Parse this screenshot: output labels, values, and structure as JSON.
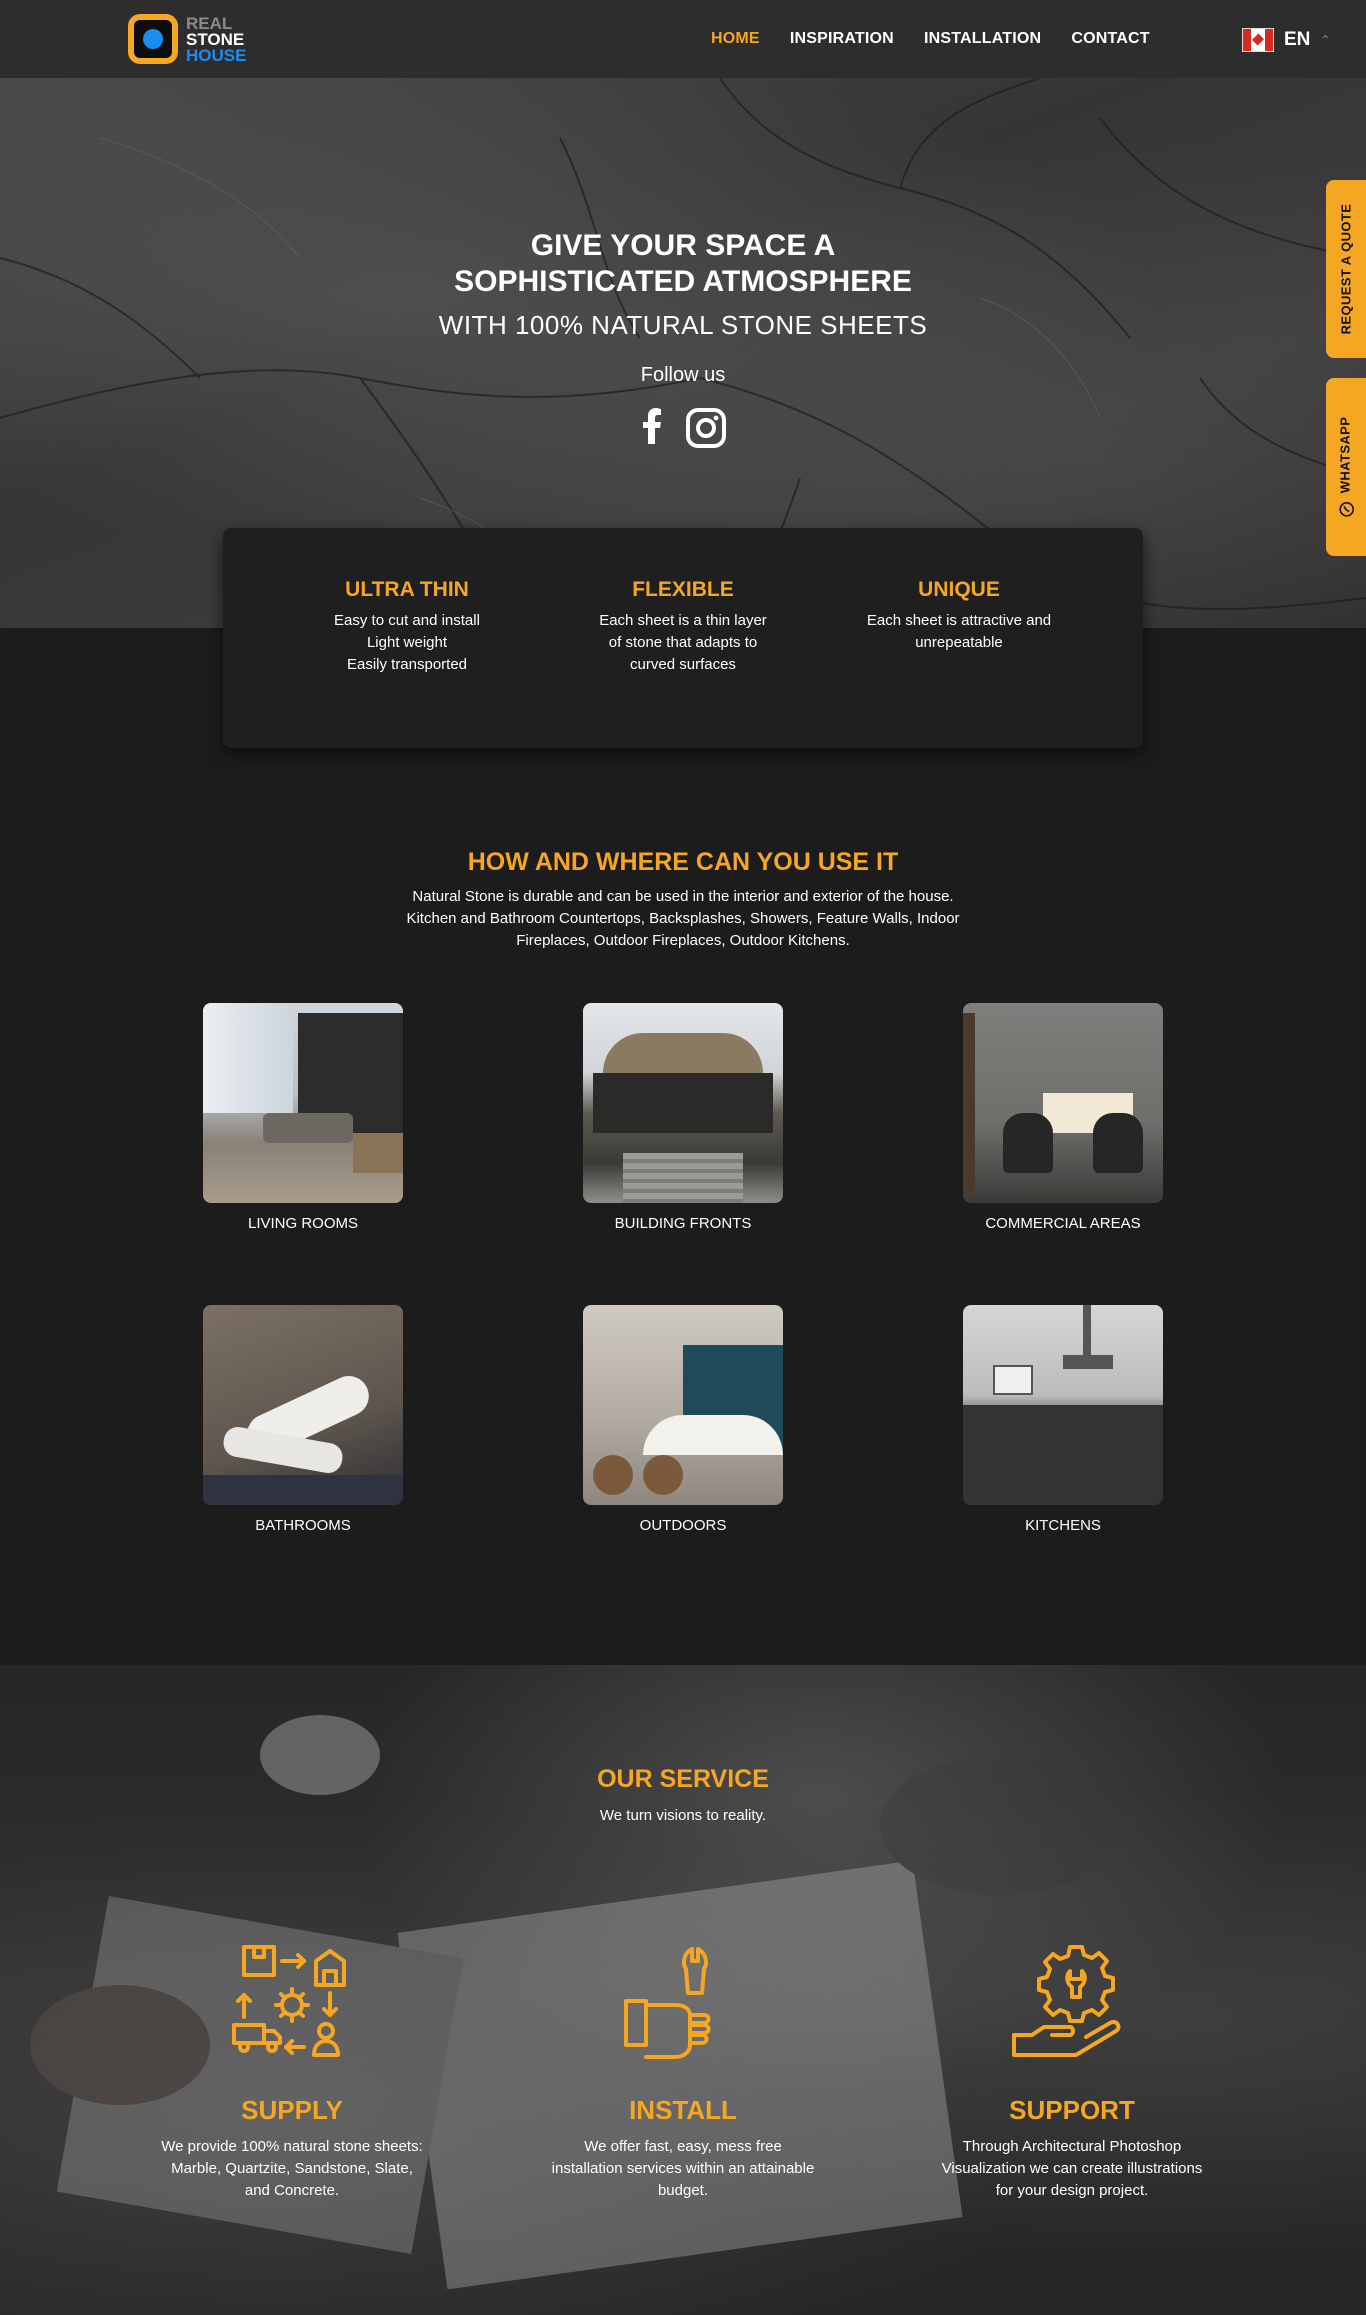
{
  "brand": {
    "line1": "REAL",
    "line2": "STONE",
    "line3": "HOUSE",
    "accent": "#f5a623",
    "blue": "#1b8df0"
  },
  "nav": {
    "items": [
      "HOME",
      "INSPIRATION",
      "INSTALLATION",
      "CONTACT"
    ],
    "active": "HOME"
  },
  "language": {
    "code": "EN",
    "flag_icon": "canada-flag-icon"
  },
  "hero": {
    "title_line1": "GIVE YOUR SPACE A",
    "title_line2": "SOPHISTICATED ATMOSPHERE",
    "subtitle": "WITH 100% NATURAL STONE SHEETS",
    "follow": "Follow us",
    "social_icons": [
      "facebook-icon",
      "instagram-icon"
    ]
  },
  "side_tabs": {
    "quote": "REQUEST A QUOTE",
    "whatsapp": "WHATSAPP"
  },
  "features": [
    {
      "title": "ULTRA THIN",
      "lines": [
        "Easy to cut and install",
        "Light weight",
        "Easily transported"
      ]
    },
    {
      "title": "FLEXIBLE",
      "lines": [
        "Each sheet is a thin layer",
        "of stone that adapts to",
        "curved surfaces"
      ]
    },
    {
      "title": "UNIQUE",
      "lines": [
        "Each sheet is attractive and",
        "unrepeatable"
      ]
    }
  ],
  "uses": {
    "title": "HOW AND WHERE CAN YOU USE IT",
    "desc_line1": "Natural Stone is durable and can be used in the interior and exterior of the house.",
    "desc_line2": "Kitchen and Bathroom Countertops, Backsplashes, Showers, Feature Walls, Indoor",
    "desc_line3": "Fireplaces, Outdoor Fireplaces, Outdoor Kitchens.",
    "items": [
      "LIVING ROOMS",
      "BUILDING FRONTS",
      "COMMERCIAL AREAS",
      "BATHROOMS",
      "OUTDOORS",
      "KITCHENS"
    ]
  },
  "service": {
    "title": "OUR SERVICE",
    "tagline": "We turn visions to reality.",
    "items": [
      {
        "title": "SUPPLY",
        "lines": [
          "We provide 100% natural stone sheets:",
          "Marble, Quartzite, Sandstone, Slate,",
          "and Concrete."
        ]
      },
      {
        "title": "INSTALL",
        "lines": [
          "We offer fast, easy, mess free",
          "installation services within an attainable",
          "budget."
        ]
      },
      {
        "title": "SUPPORT",
        "lines": [
          "Through Architectural Photoshop",
          "Visualization we can create illustrations",
          "for your design project."
        ]
      }
    ]
  }
}
